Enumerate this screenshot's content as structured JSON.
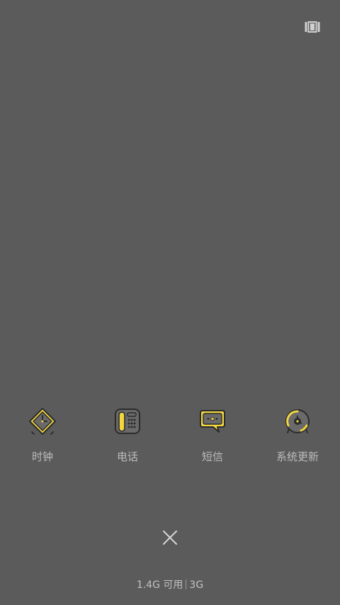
{
  "top_right": {
    "icon": "multi-window-icon"
  },
  "apps": [
    {
      "label": "时钟",
      "icon": "clock-icon"
    },
    {
      "label": "电话",
      "icon": "phone-icon"
    },
    {
      "label": "短信",
      "icon": "message-icon"
    },
    {
      "label": "系统更新",
      "icon": "system-update-icon"
    }
  ],
  "close": {
    "icon": "close-icon"
  },
  "memory": {
    "available": "1.4G 可用",
    "total": "3G"
  },
  "colors": {
    "background": "#5b5b5b",
    "icon_accent": "#f1d640",
    "icon_outline": "#2b2b2b",
    "label_text": "#bcbcbc"
  }
}
